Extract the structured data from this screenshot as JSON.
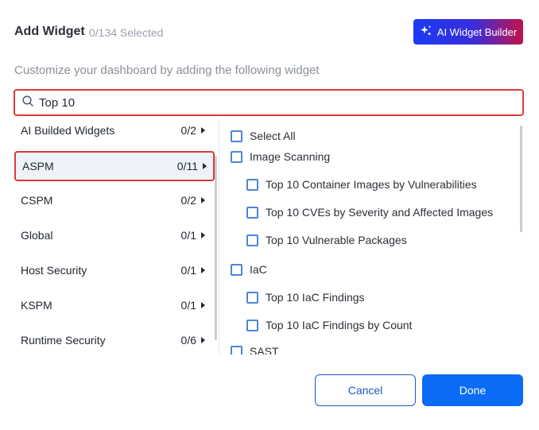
{
  "header": {
    "title": "Add Widget",
    "selected_count": "0/134 Selected",
    "ai_button_label": "AI Widget Builder",
    "ai_icon": "sparkle-icon"
  },
  "subtitle": "Customize your dashboard by adding the following widget",
  "search": {
    "icon": "search-icon",
    "value": "Top 10"
  },
  "categories": [
    {
      "label": "AI Builded Widgets",
      "count": "0/2"
    },
    {
      "label": "ASPM",
      "count": "0/11",
      "active": true
    },
    {
      "label": "CSPM",
      "count": "0/2"
    },
    {
      "label": "Global",
      "count": "0/1"
    },
    {
      "label": "Host Security",
      "count": "0/1"
    },
    {
      "label": "KSPM",
      "count": "0/1"
    },
    {
      "label": "Runtime Security",
      "count": "0/6"
    }
  ],
  "widgets": {
    "select_all": "Select All",
    "groups": [
      {
        "name": "Image Scanning",
        "items": [
          "Top 10 Container Images by Vulnerabilities",
          "Top 10 CVEs by Severity and Affected Images",
          "Top 10 Vulnerable Packages"
        ]
      },
      {
        "name": "IaC",
        "items": [
          "Top 10 IaC Findings",
          "Top 10 IaC Findings by Count"
        ]
      },
      {
        "name": "SAST",
        "items": []
      }
    ]
  },
  "footer": {
    "cancel_label": "Cancel",
    "done_label": "Done"
  },
  "colors": {
    "accent": "#0a6cf5",
    "highlight_border": "#d93a3a",
    "checkbox_border": "#4a86d9"
  }
}
